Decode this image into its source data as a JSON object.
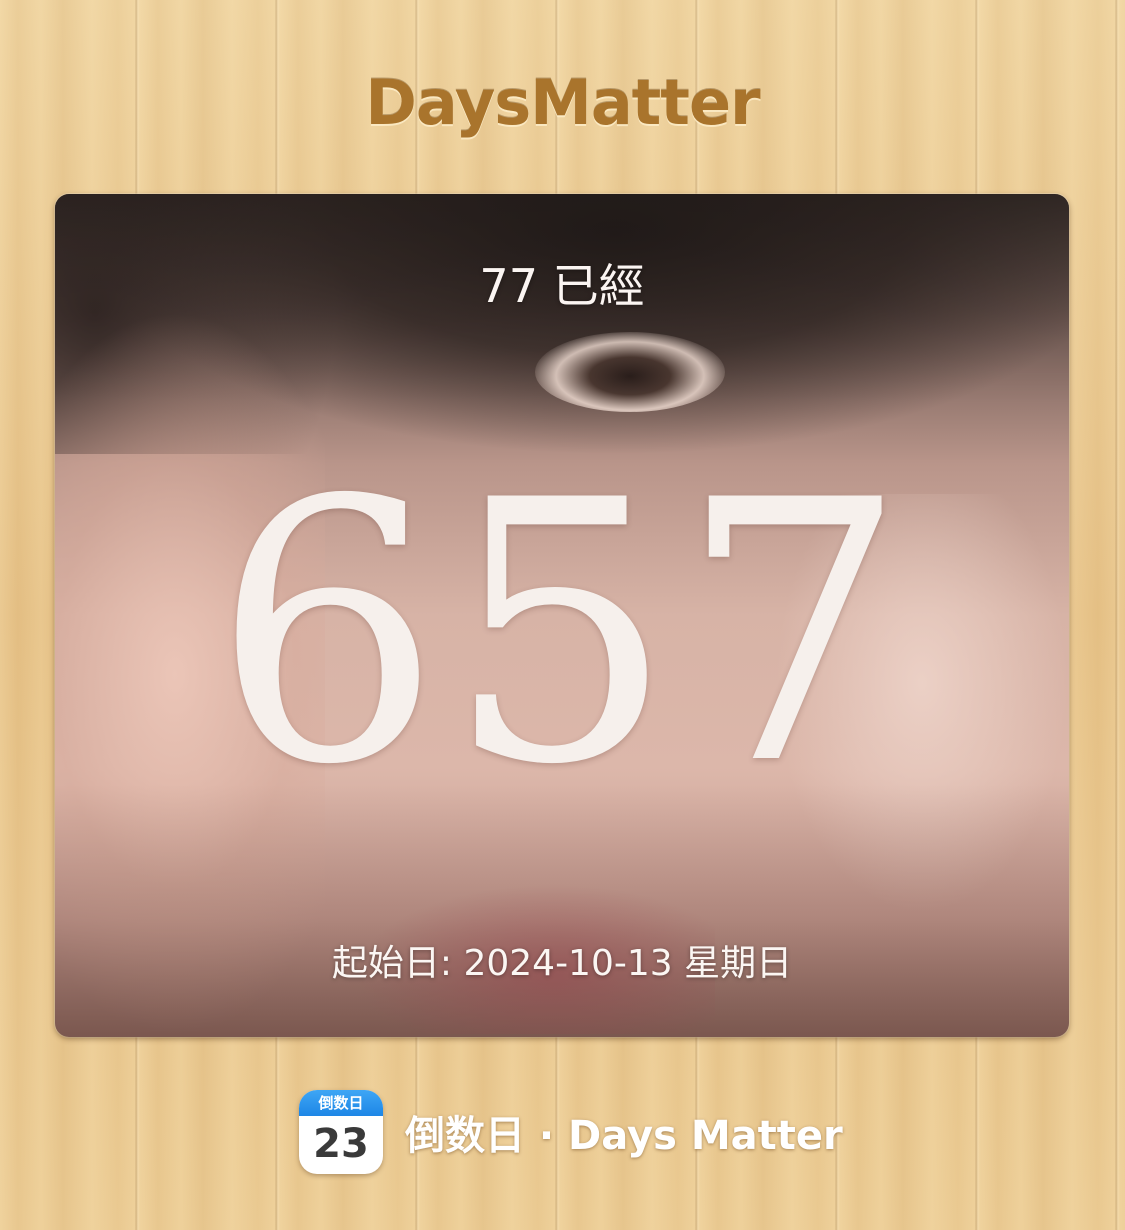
{
  "header": {
    "brand_title": "DaysMatter"
  },
  "card": {
    "event_title": "77 已經",
    "day_count": "657",
    "start_date_line": "起始日: 2024-10-13 星期日"
  },
  "footer": {
    "app_icon": {
      "header_label": "倒数日",
      "number": "23",
      "icon_name": "calendar-app-icon"
    },
    "app_name": "倒数日 · Days Matter"
  },
  "colors": {
    "brand_title": "#a9742c",
    "wood_background": "#e8c98f",
    "icon_header_blue": "#1d86e6",
    "card_text": "#fbf5f2"
  }
}
